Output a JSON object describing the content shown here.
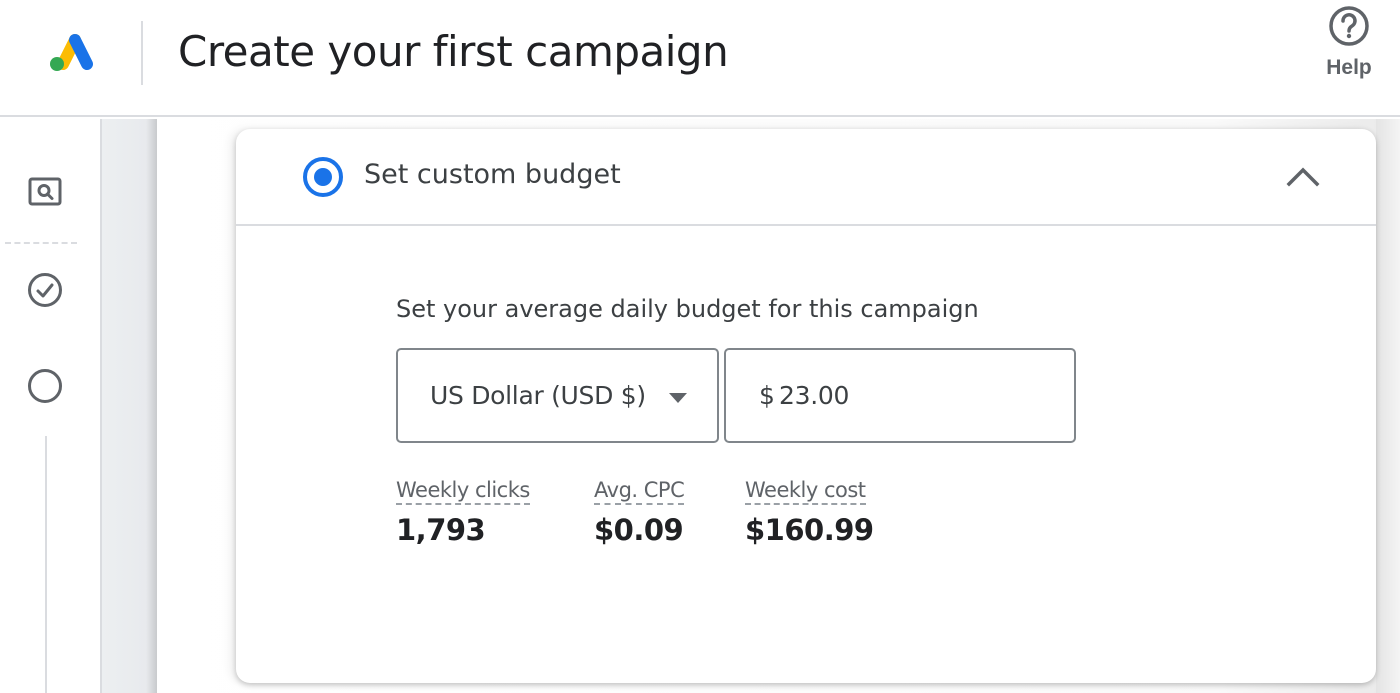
{
  "header": {
    "title": "Create your first campaign",
    "logo": "google-ads-logo",
    "help": {
      "label": "Help",
      "icon": "help-circle-icon"
    }
  },
  "stepper": {
    "steps": [
      {
        "icon": "search-preview-icon",
        "state": "current"
      },
      {
        "icon": "check-circle-icon",
        "state": "completed"
      },
      {
        "icon": "empty-circle-icon",
        "state": "pending"
      }
    ]
  },
  "budget_card": {
    "option_label": "Set custom budget",
    "selected": true,
    "expanded": true,
    "collapse_icon": "chevron-up-icon",
    "prompt": "Set your average daily budget for this campaign",
    "currency": {
      "selected": "US Dollar (USD $)",
      "icon": "dropdown-arrow-icon"
    },
    "amount": {
      "prefix": "$",
      "value": "23.00"
    },
    "metrics": [
      {
        "label": "Weekly clicks",
        "value": "1,793"
      },
      {
        "label": "Avg. CPC",
        "value": "$0.09"
      },
      {
        "label": "Weekly cost",
        "value": "$160.99"
      }
    ]
  },
  "colors": {
    "accent": "#1a73e8",
    "text_primary": "#202124",
    "text_secondary": "#5f6368",
    "border": "#dadce0"
  }
}
